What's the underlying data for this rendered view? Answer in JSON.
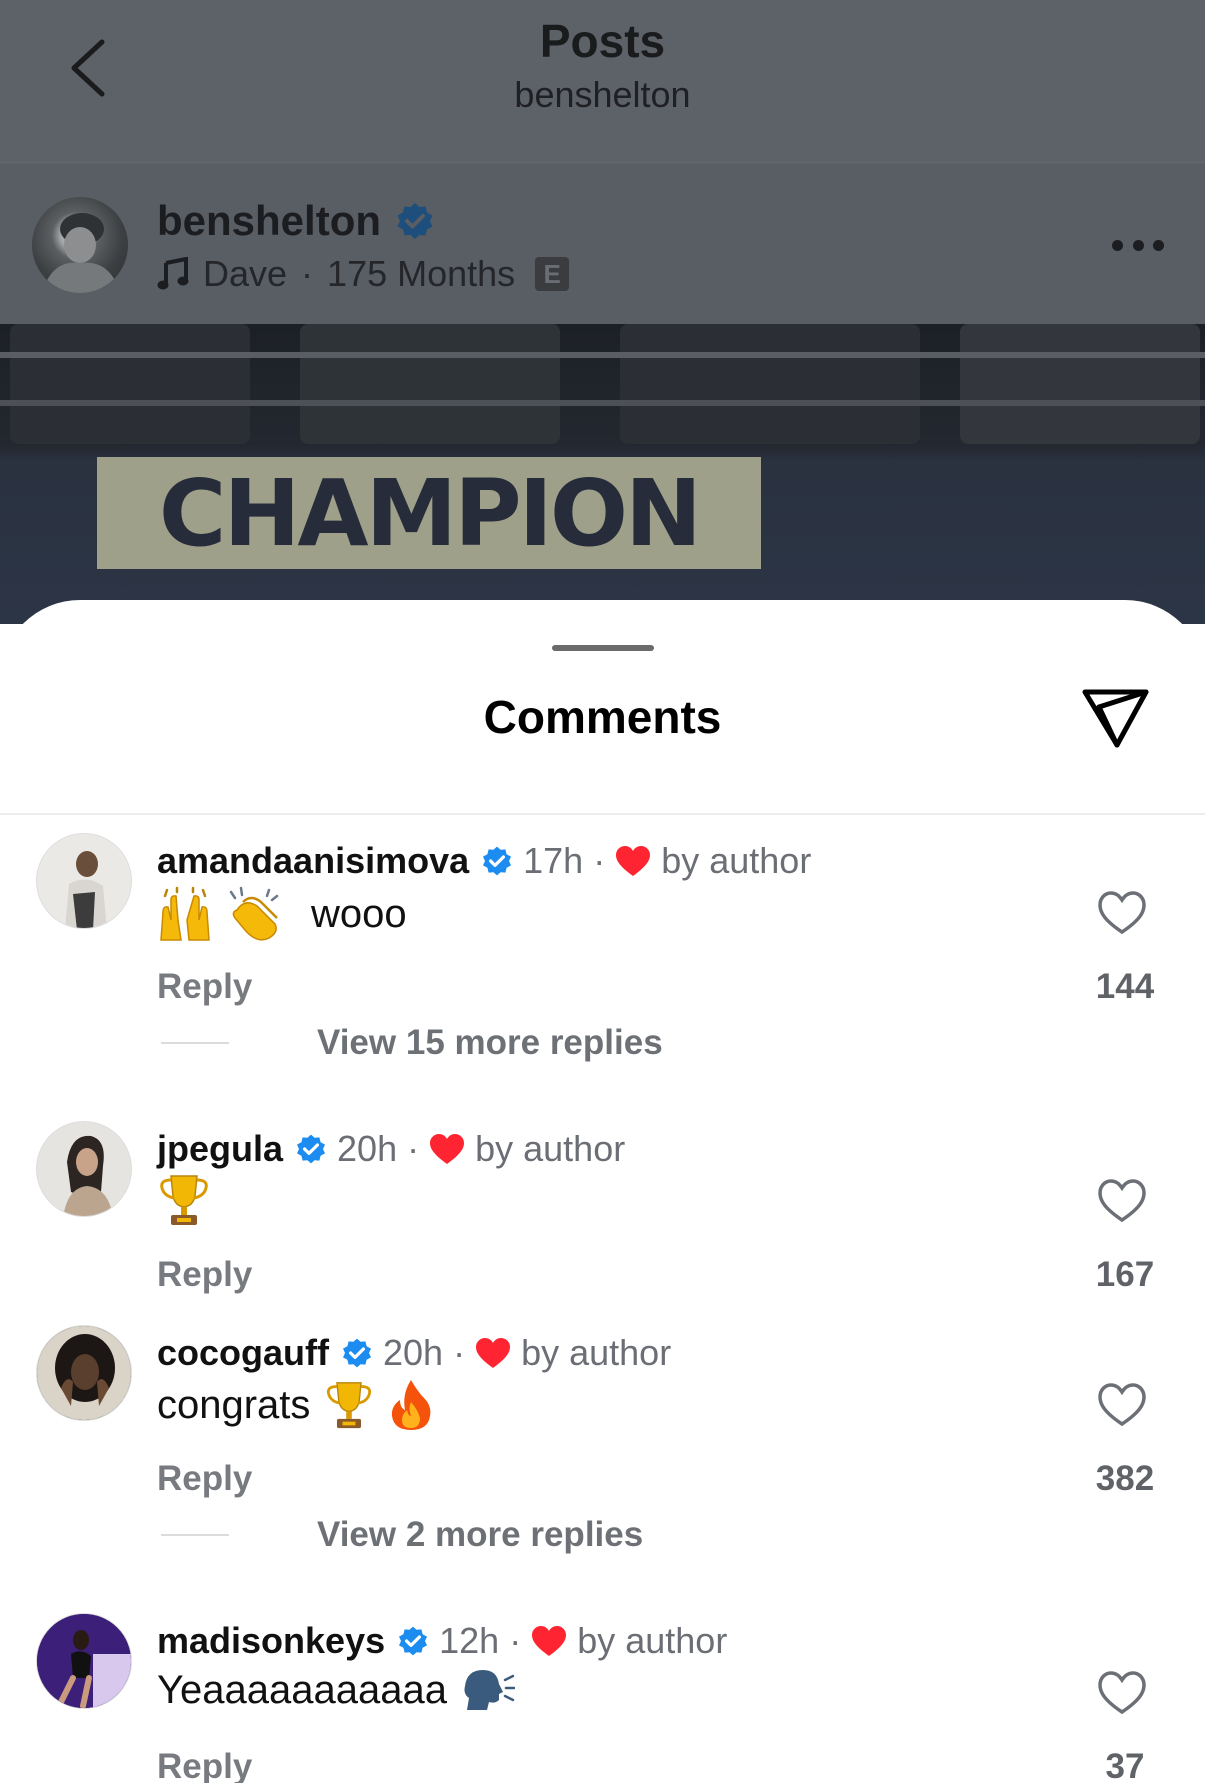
{
  "nav": {
    "title": "Posts",
    "subtitle": "benshelton"
  },
  "post": {
    "username": "benshelton",
    "music_artist": "Dave",
    "music_separator": "·",
    "music_track": "175 Months",
    "explicit_badge": "E",
    "image_text": "CHAMPION"
  },
  "sheet": {
    "title": "Comments"
  },
  "comments": [
    {
      "username": "amandaanisimova",
      "time": "17h",
      "separator": "·",
      "liked_by": "by author",
      "text": "wooo",
      "emojis": [
        "raising-hands",
        "clapping-hands"
      ],
      "reply_label": "Reply",
      "likes": "144",
      "more_replies": "View 15 more replies"
    },
    {
      "username": "jpegula",
      "time": "20h",
      "separator": "·",
      "liked_by": "by author",
      "text": "",
      "emojis": [
        "trophy"
      ],
      "reply_label": "Reply",
      "likes": "167",
      "more_replies": ""
    },
    {
      "username": "cocogauff",
      "time": "20h",
      "separator": "·",
      "liked_by": "by author",
      "text": "congrats",
      "emojis": [
        "trophy",
        "fire"
      ],
      "reply_label": "Reply",
      "likes": "382",
      "more_replies": "View 2 more replies"
    },
    {
      "username": "madisonkeys",
      "time": "12h",
      "separator": "·",
      "liked_by": "by author",
      "text": "Yeaaaaaaaaaaa",
      "emojis": [
        "speaking-head"
      ],
      "reply_label": "Reply",
      "likes": "37",
      "more_replies": ""
    }
  ],
  "colors": {
    "verified": "#1d8cf0",
    "heart_red": "#ff2431",
    "dim_overlay": "#5d6168"
  }
}
